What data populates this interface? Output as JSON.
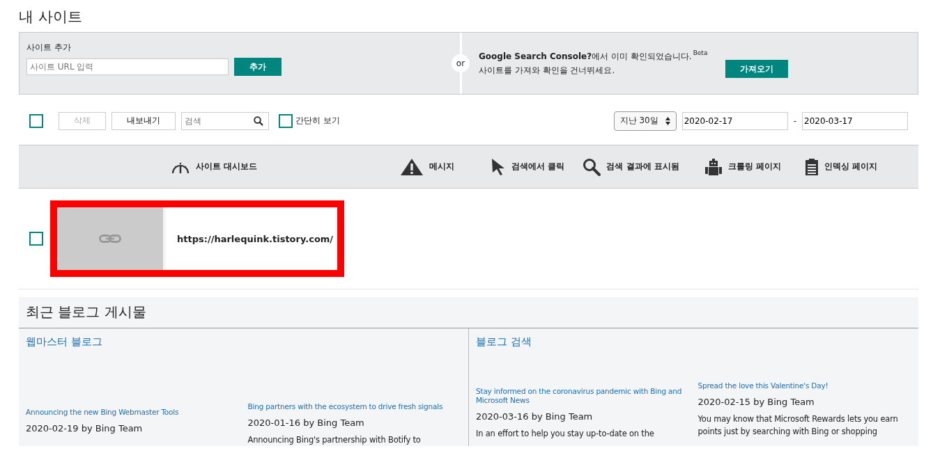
{
  "page_title": "내 사이트",
  "add_site": {
    "label": "사이트 추가",
    "placeholder": "사이트 URL 입력",
    "button": "추가"
  },
  "separator": "or",
  "import": {
    "line1": "**Google Search Console?**에서 이미 확인되었습니다.",
    "badge": "Beta",
    "line2": "사이트를 가져와 확인을 건너뛰세요.",
    "button": "가져오기"
  },
  "toolbar": {
    "select_all_checked": false,
    "delete": {
      "label": "삭제",
      "disabled": true
    },
    "export": {
      "label": "내보내기",
      "disabled": false
    },
    "search_placeholder": "검색",
    "compact_view": {
      "label": "간단히 보기",
      "checked": false
    },
    "period": "지난 30일",
    "date_from": "2020-02-17",
    "date_sep": "-",
    "date_to": "2020-03-17"
  },
  "columns": [
    {
      "label": "사이트 대시보드"
    },
    {
      "label": "메시지"
    },
    {
      "label": "검색에서 클릭"
    },
    {
      "label": "검색 결과에 표시됨"
    },
    {
      "label": "크롤링 페이지"
    },
    {
      "label": "인덱싱 페이지"
    }
  ],
  "sites": [
    {
      "url": "https://harlequink.tistory.com/",
      "checked": false,
      "highlighted": true
    }
  ],
  "blog": {
    "title": "최근 블로그 게시물",
    "sections": [
      {
        "title": "웹마스터 블로그",
        "posts": [
          {
            "title": "Announcing the new Bing Webmaster Tools",
            "meta": "2020-02-19 by Bing Team"
          },
          {
            "title": "Bing partners with the ecosystem to drive fresh signals",
            "meta": "2020-01-16 by Bing Team",
            "body": "Announcing Bing's partnership with Botify to"
          }
        ]
      },
      {
        "title": "블로그 검색",
        "posts": [
          {
            "title": "Stay informed on the coronavirus pandemic with Bing and Microsoft News",
            "meta": "2020-03-16 by Bing Team",
            "body": "In an effort to help you stay up-to-date on the"
          },
          {
            "title": "Spread the love this Valentine's Day!",
            "meta": "2020-02-15 by Bing Team",
            "body": "You may know that Microsoft Rewards lets you earn points just by searching with Bing or shopping"
          }
        ]
      }
    ]
  }
}
